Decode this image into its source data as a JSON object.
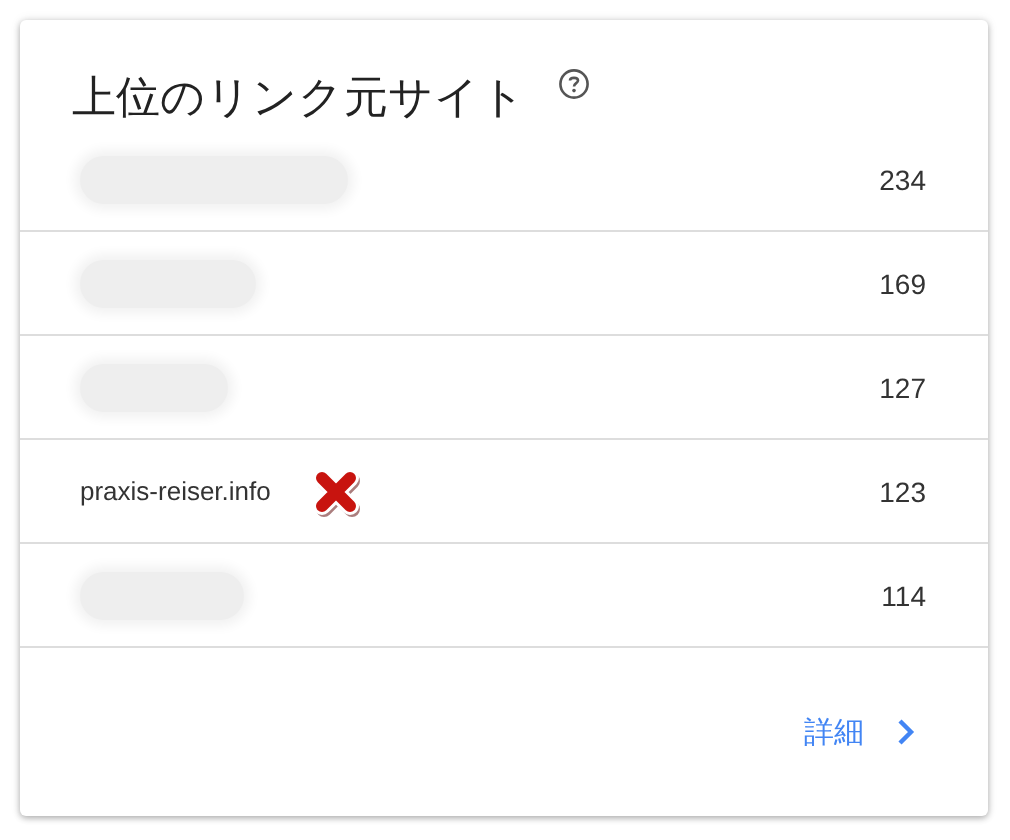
{
  "card": {
    "title": "上位のリンク元サイト"
  },
  "rows": [
    {
      "kind": "redacted",
      "count": "234"
    },
    {
      "kind": "redacted",
      "count": "169"
    },
    {
      "kind": "redacted",
      "count": "127"
    },
    {
      "kind": "site",
      "name": "praxis-reiser.info",
      "rejected": true,
      "count": "123"
    },
    {
      "kind": "redacted",
      "count": "114"
    }
  ],
  "footer": {
    "link": "詳細"
  }
}
